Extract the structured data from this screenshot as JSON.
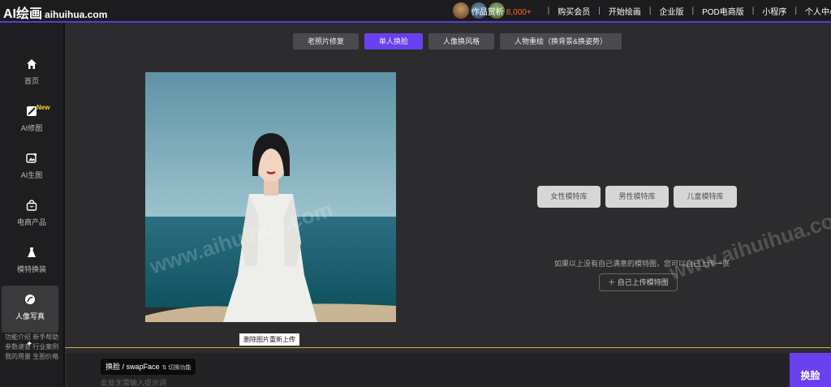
{
  "header": {
    "logo_main": "AI绘画",
    "logo_sub": "aihuihua.com",
    "gallery_label": "作品赏析",
    "gallery_count": "8,000+",
    "nav": [
      "购买会员",
      "开始绘画",
      "企业版",
      "POD电商版",
      "小程序",
      "个人中心"
    ]
  },
  "sidebar": {
    "items": [
      {
        "label": "首页",
        "icon": "home-icon"
      },
      {
        "label": "AI修图",
        "icon": "edit-image-icon",
        "badge": "New"
      },
      {
        "label": "AI生图",
        "icon": "image-gen-icon"
      },
      {
        "label": "电商产品",
        "icon": "shopping-bag-icon"
      },
      {
        "label": "模特换装",
        "icon": "dress-icon"
      },
      {
        "label": "人像写真",
        "icon": "portrait-icon"
      }
    ],
    "links": [
      "功能介绍",
      "新手帮助",
      "参数速查",
      "行业案例",
      "我的用量",
      "生图价格"
    ]
  },
  "tabs": [
    "老照片修复",
    "单人换脸",
    "人像换风格",
    "人物重绘（换背景&换姿势）"
  ],
  "photo": {
    "delete_label": "删除图片重新上传"
  },
  "library": {
    "buttons": [
      "女性模特库",
      "男性模特库",
      "儿童模特库"
    ],
    "hint": "如果以上没有自己满意的模特图，您可以自己上传一张",
    "upload_label": "＋ 自己上传模特图"
  },
  "watermark": "www.aihuihua.com",
  "bottom": {
    "mode_label": "换脸 / swapFace",
    "switch_label": "⇅ 切换功能",
    "placeholder": "此处无需输入提示词",
    "submit_label": "换脸"
  },
  "colors": {
    "accent": "#6a3ff0",
    "count": "#ff6a2a",
    "badge": "#ffd12a"
  }
}
